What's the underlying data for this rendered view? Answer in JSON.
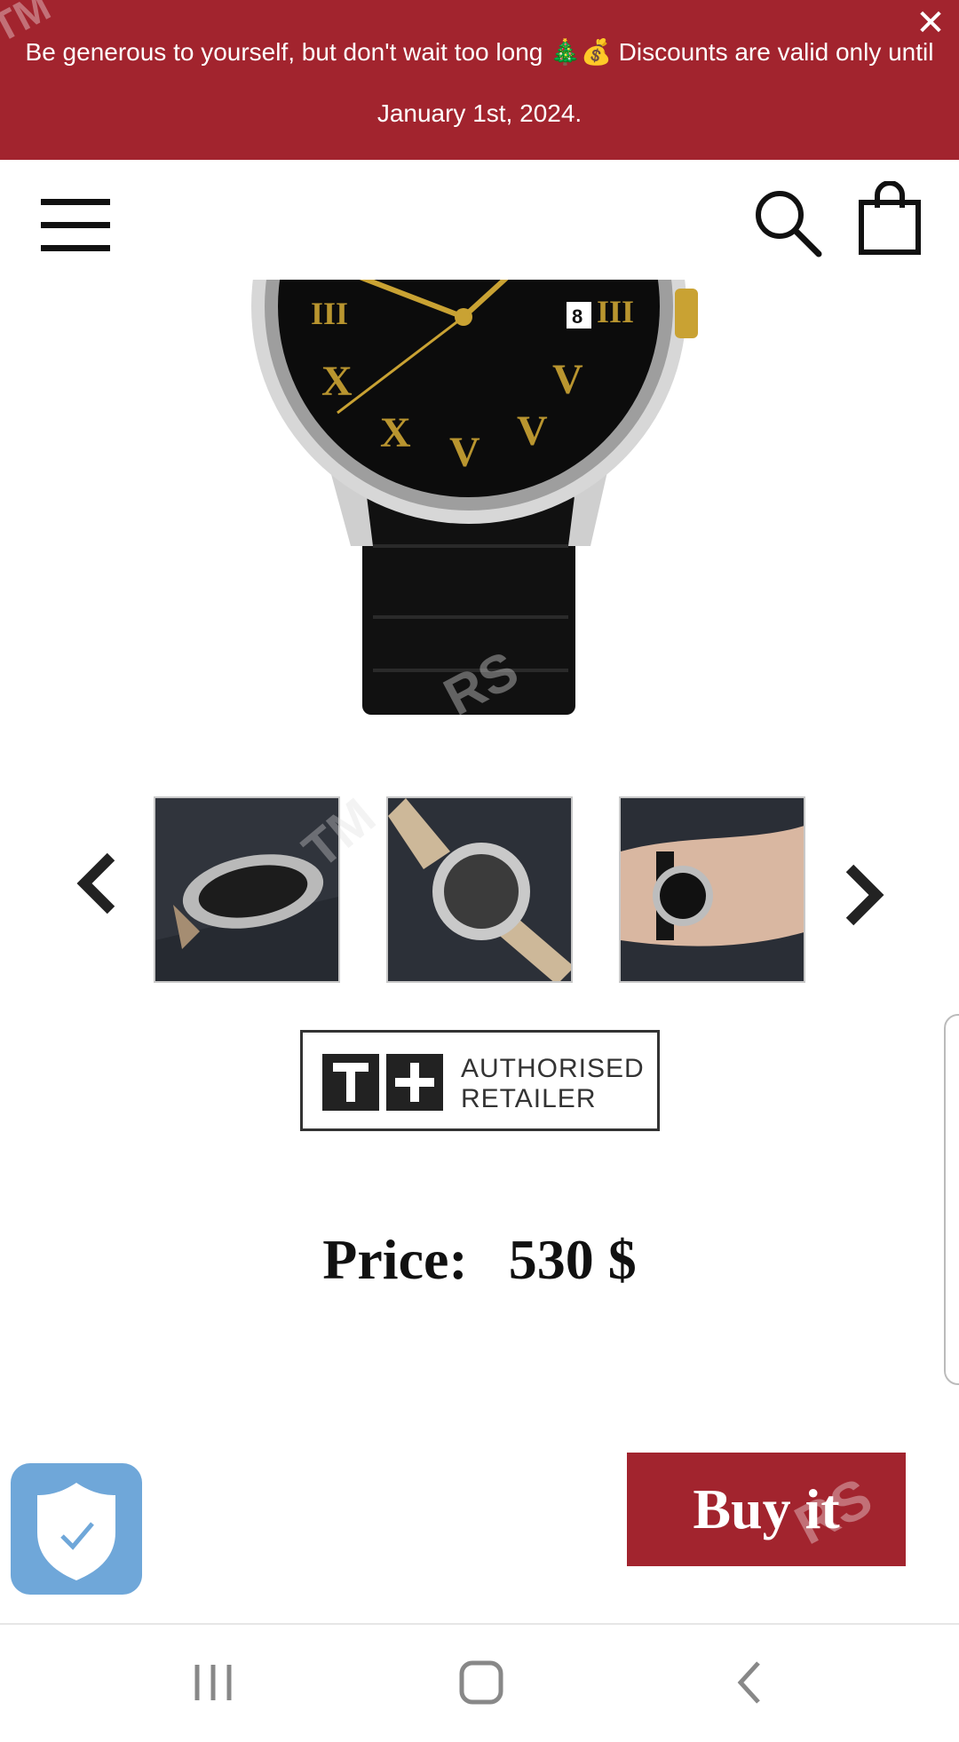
{
  "announcement": {
    "text": "Be generous to yourself, but don't wait too long 🎄💰 Discounts are valid only until January 1st, 2024.",
    "close_label": "✕",
    "background": "#a2242e"
  },
  "header": {
    "menu_icon": "hamburger-menu-icon",
    "search_icon": "search-icon",
    "cart_icon": "shopping-bag-icon"
  },
  "gallery": {
    "main_image": "black dial watch with gold roman numerals and black leather strap",
    "prev_icon": "chevron-left-icon",
    "next_icon": "chevron-right-icon",
    "thumbnails": [
      {
        "name": "watch-side-view"
      },
      {
        "name": "watch-back-view"
      },
      {
        "name": "watch-on-wrist"
      }
    ],
    "date_window": "8"
  },
  "retailer_badge": {
    "logo_text": "T+",
    "line1": "AUTHORISED",
    "line2": "RETAILER"
  },
  "price": {
    "label": "Price:",
    "value": "530 $"
  },
  "buy_button": {
    "label": "Buy it",
    "background": "#a2242e"
  },
  "system_nav": {
    "recents_icon": "recent-apps-icon",
    "home_icon": "home-icon",
    "back_icon": "back-icon"
  }
}
